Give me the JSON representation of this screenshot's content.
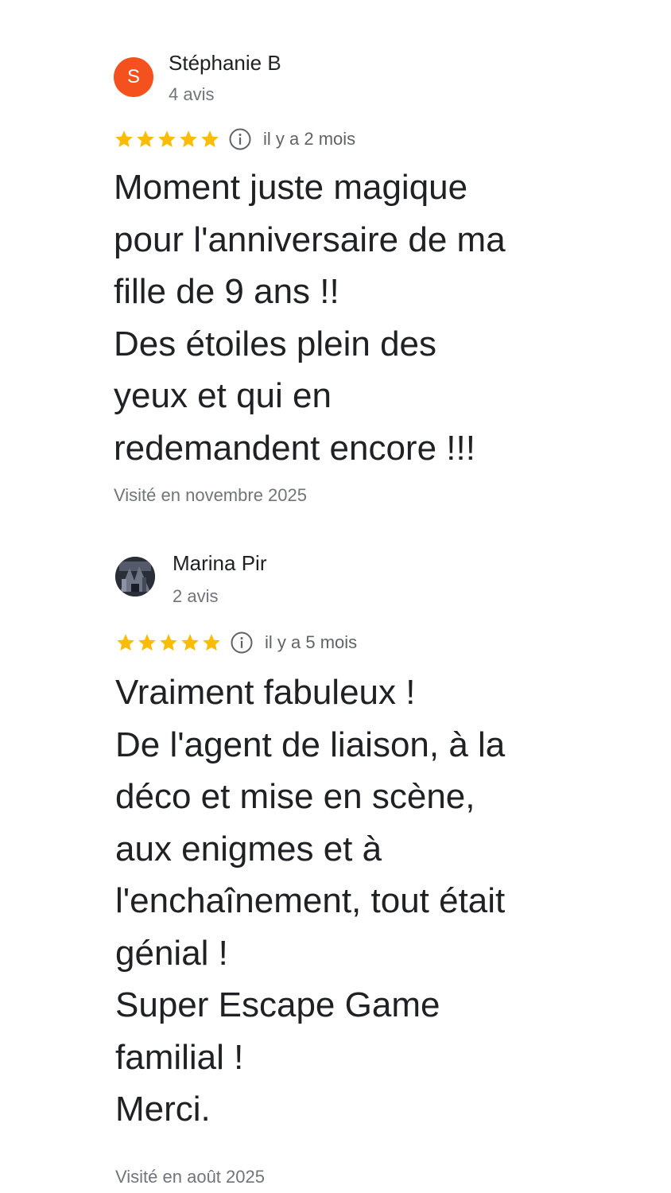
{
  "colors": {
    "star": "#fbbc04",
    "avatar_s_bg": "#f4511e",
    "text_primary": "#202124",
    "text_secondary": "#70757a"
  },
  "reviews": [
    {
      "avatar_letter": "S",
      "name": "Stéphanie B",
      "review_count": "4 avis",
      "rating": 5,
      "relative_date": "il y a 2 mois",
      "lines": [
        "Moment juste magique",
        "pour l'anniversaire de ma",
        "fille de 9 ans !!",
        "Des étoiles plein des",
        "yeux et qui en",
        "redemandent encore !!!"
      ],
      "visited": "Visité en novembre 2025"
    },
    {
      "avatar_letter": "",
      "name": "Marina Pir",
      "review_count": "2 avis",
      "rating": 5,
      "relative_date": "il y a 5 mois",
      "lines": [
        "Vraiment fabuleux !",
        "De l'agent de liaison, à la",
        "déco et mise en scène,",
        "aux enigmes et à",
        "l'enchaînement, tout était",
        "génial !",
        "Super Escape Game",
        "familial !",
        "Merci."
      ],
      "visited": "Visité en août 2025"
    }
  ]
}
